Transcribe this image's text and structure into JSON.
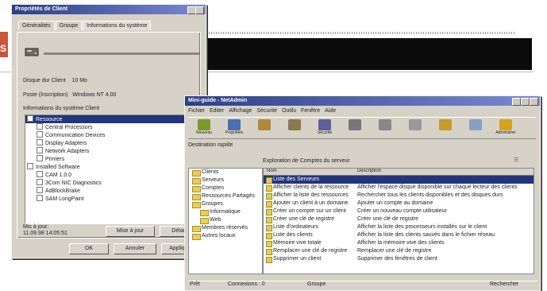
{
  "banner": {
    "letter": "S"
  },
  "props_window": {
    "title": "Propriétés de Client",
    "tabs": [
      "Généralités",
      "Groupe",
      "Informations du système"
    ],
    "disk_size_label": "Disque dur Client",
    "disk_size_value": "10 Mo",
    "os_label": "Poste (Inscription)",
    "os_value": "Windows NT 4.00",
    "section": "Informations du système Client",
    "tree": [
      {
        "label": "Ressource",
        "selected": true
      },
      {
        "label": "Central Processors"
      },
      {
        "label": "Communication Devices"
      },
      {
        "label": "Display Adapters"
      },
      {
        "label": "Network Adapters"
      },
      {
        "label": "Printers"
      },
      {
        "label": "Installed Software"
      },
      {
        "label": "CAM 1.0.0"
      },
      {
        "label": "3Com NIC Diagnostics"
      },
      {
        "label": "AdBlockBrake"
      },
      {
        "label": "SAM LongPaint"
      }
    ],
    "footer_line1": "Mis à jour:",
    "footer_line2": "11.09.98 14:05:51",
    "btn_update": "Mise à jour",
    "btn_details": "Détails",
    "btn_ok": "OK",
    "btn_cancel": "Annuler",
    "btn_apply": "Appliquer"
  },
  "explorer": {
    "title": "Mini-guide - NetAdmin",
    "menu": [
      "Fichier",
      "Editer",
      "Affichage",
      "Sécurité",
      "Outils",
      "Fenêtre",
      "Aide"
    ],
    "tools": [
      "Nouveau",
      "Propriétés",
      "",
      "",
      "Sécurité",
      "",
      "",
      "",
      "",
      "",
      "Administrer"
    ],
    "address": "Destination rapide",
    "address_sub": "Exploration de Comptes du serveur",
    "col_name": "Nom",
    "col_desc": "Description",
    "folders": [
      "Clients",
      "Serveurs",
      "Comptes",
      "Ressources Partagés",
      "Groupes",
      "Informatique",
      "Web",
      "Membres réservés",
      "Autres locaux"
    ],
    "rows": [
      {
        "name": "Liste des Serveurs",
        "desc": "",
        "selected": true
      },
      {
        "name": "Afficher clients de la ressource",
        "desc": "Afficher l'espace disque disponible sur chaque lecteur des clients"
      },
      {
        "name": "Afficher la liste des ressources",
        "desc": "Rechercher tous les clients disponibles et des disques durs"
      },
      {
        "name": "Ajouter un client à un domaine",
        "desc": "Ajouter un compte au domaine"
      },
      {
        "name": "Créer un compte sur un client",
        "desc": "Créer un nouveau compte utilisateur"
      },
      {
        "name": "Créer une clé de registre",
        "desc": "Créer une clé de registre"
      },
      {
        "name": "Liste d'ordinateurs",
        "desc": "Afficher la liste des processeurs installés sur le client"
      },
      {
        "name": "Liste des clients",
        "desc": "Afficher la liste des clients sauvés dans le fichier réseau"
      },
      {
        "name": "Mémoire vive totale",
        "desc": "Afficher la mémoire vive des clients"
      },
      {
        "name": "Remplacer une clé de registre",
        "desc": "Remplacer une clé de registre"
      },
      {
        "name": "Supprimer un client",
        "desc": "Supprimer des fenêtres de client"
      }
    ],
    "status_left": "Prêt",
    "status_mid": "Connexions : 0",
    "status_right": "Groupe",
    "status_far": "Rechercher"
  },
  "colors": {
    "titlebar": "#2b3f86",
    "selection": "#23357f",
    "banner": "#0b0b0b",
    "tab_accent": "#c8553c"
  }
}
